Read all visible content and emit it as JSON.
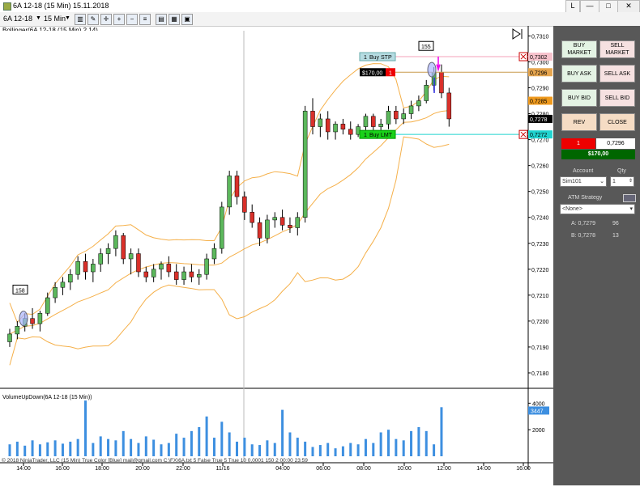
{
  "window": {
    "title": "6A 12-18 (15 Min)  15.11.2018",
    "btn_help": "L",
    "btn_min": "—",
    "btn_max": "□",
    "btn_close": "✕"
  },
  "toolbar": {
    "instrument": "6A 12-18",
    "interval": "15 Min"
  },
  "indicator_labels": {
    "bollinger": "Bollinger(6A 12-18 (15 Min),2,14)",
    "volume": "VolumeUpDown(6A 12-18 (15 Min))"
  },
  "price_axis": [
    "0,7310",
    "0,7300",
    "0,7290",
    "0,7280",
    "0,7270",
    "0,7260",
    "0,7250",
    "0,7240",
    "0,7230",
    "0,7220",
    "0,7210",
    "0,7200",
    "0,7190",
    "0,7180"
  ],
  "price_tags": {
    "stop": "0,7302",
    "upper": "0,7296",
    "mid": "0,7285",
    "last": "0,7278",
    "limit": "0,7272"
  },
  "orders": {
    "stop_label": "Buy STP",
    "stop_qty": "1",
    "limit_label": "Buy LMT",
    "limit_qty": "1",
    "pnl": "$170,00",
    "position_qty": "1"
  },
  "markers": {
    "bar_count_left": "158",
    "bar_count_right": "155"
  },
  "time_axis": [
    "14:00",
    "16:00",
    "18:00",
    "20:00",
    "22:00",
    "11/16",
    "04:00",
    "06:00",
    "08:00",
    "10:00",
    "12:00",
    "14:00",
    "16:00"
  ],
  "volume_axis": {
    "top": "4000",
    "bottom": "2000",
    "current": "3447"
  },
  "footer": "© 2018 NinjaTrader, LLC  (15 Min) True Color [Blue] mail@gmail.com C:\\FX\\6A.txt 5 False True 5 True 10 0,0001 150 2 00:00 23:59",
  "panel": {
    "buy_market": "BUY MARKET",
    "sell_market": "SELL MARKET",
    "buy_ask": "BUY ASK",
    "sell_ask": "SELL ASK",
    "buy_bid": "BUY BID",
    "sell_bid": "SELL BID",
    "rev": "REV",
    "close": "CLOSE",
    "pos_qty": "1",
    "pos_price": "0,7296",
    "pnl": "$170,00",
    "account_label": "Account",
    "qty_label": "Qty",
    "account": "Sim101",
    "qty": "1",
    "atm_label": "ATM Strategy",
    "atm": "<None>",
    "ask_label": "A: 0,7279",
    "ask_size": "96",
    "bid_label": "B: 0,7278",
    "bid_size": "13"
  },
  "colors": {
    "up": "#5cb85c",
    "down": "#d9302a",
    "band": "#f5b04a",
    "volume": "#3d8fe0",
    "panel": "#585858"
  },
  "chart_data": {
    "type": "candlestick",
    "title": "6A 12-18 (15 Min)",
    "ylim": [
      0.7175,
      0.7312
    ],
    "candles": [
      [
        0.7192,
        0.7197,
        0.719,
        0.7195
      ],
      [
        0.7195,
        0.72,
        0.7193,
        0.7198
      ],
      [
        0.7198,
        0.7203,
        0.7196,
        0.7201
      ],
      [
        0.7201,
        0.7205,
        0.7197,
        0.7199
      ],
      [
        0.7199,
        0.7204,
        0.7196,
        0.7203
      ],
      [
        0.7203,
        0.7211,
        0.7202,
        0.7209
      ],
      [
        0.7209,
        0.7215,
        0.7207,
        0.7213
      ],
      [
        0.7213,
        0.7217,
        0.721,
        0.7215
      ],
      [
        0.7215,
        0.722,
        0.7212,
        0.7218
      ],
      [
        0.7218,
        0.7225,
        0.7216,
        0.7223
      ],
      [
        0.7223,
        0.7226,
        0.7216,
        0.7219
      ],
      [
        0.7219,
        0.7224,
        0.7215,
        0.7222
      ],
      [
        0.7222,
        0.7228,
        0.7219,
        0.7226
      ],
      [
        0.7226,
        0.723,
        0.7222,
        0.7228
      ],
      [
        0.7228,
        0.7235,
        0.7225,
        0.7233
      ],
      [
        0.7233,
        0.7234,
        0.7222,
        0.7224
      ],
      [
        0.7224,
        0.7228,
        0.7218,
        0.7226
      ],
      [
        0.7226,
        0.7228,
        0.7217,
        0.7219
      ],
      [
        0.7219,
        0.7221,
        0.7215,
        0.7217
      ],
      [
        0.7217,
        0.7222,
        0.7215,
        0.722
      ],
      [
        0.722,
        0.7223,
        0.7216,
        0.7222
      ],
      [
        0.7222,
        0.7225,
        0.7217,
        0.7219
      ],
      [
        0.7219,
        0.7222,
        0.7214,
        0.7216
      ],
      [
        0.7216,
        0.7221,
        0.7214,
        0.7219
      ],
      [
        0.7219,
        0.7222,
        0.7215,
        0.7217
      ],
      [
        0.7217,
        0.722,
        0.7214,
        0.7218
      ],
      [
        0.7218,
        0.7226,
        0.7216,
        0.7224
      ],
      [
        0.7224,
        0.723,
        0.7222,
        0.7228
      ],
      [
        0.7228,
        0.7246,
        0.7226,
        0.7244
      ],
      [
        0.7244,
        0.7258,
        0.7241,
        0.7256
      ],
      [
        0.7256,
        0.7258,
        0.7245,
        0.7248
      ],
      [
        0.7248,
        0.725,
        0.7239,
        0.7242
      ],
      [
        0.7242,
        0.7245,
        0.7236,
        0.7238
      ],
      [
        0.7238,
        0.724,
        0.7229,
        0.7232
      ],
      [
        0.7232,
        0.7241,
        0.723,
        0.7239
      ],
      [
        0.7239,
        0.7242,
        0.7236,
        0.724
      ],
      [
        0.724,
        0.7243,
        0.7235,
        0.7237
      ],
      [
        0.7237,
        0.724,
        0.7234,
        0.7236
      ],
      [
        0.7236,
        0.7242,
        0.7233,
        0.724
      ],
      [
        0.724,
        0.7283,
        0.7238,
        0.7281
      ],
      [
        0.7281,
        0.7286,
        0.7272,
        0.7275
      ],
      [
        0.7275,
        0.728,
        0.7271,
        0.7278
      ],
      [
        0.7278,
        0.7281,
        0.727,
        0.7273
      ],
      [
        0.7273,
        0.7277,
        0.727,
        0.7276
      ],
      [
        0.7276,
        0.7278,
        0.7272,
        0.7274
      ],
      [
        0.7274,
        0.7277,
        0.727,
        0.7272
      ],
      [
        0.7272,
        0.7276,
        0.7271,
        0.7275
      ],
      [
        0.7275,
        0.728,
        0.7273,
        0.7279
      ],
      [
        0.7279,
        0.728,
        0.7273,
        0.7275
      ],
      [
        0.7275,
        0.7278,
        0.7273,
        0.7276
      ],
      [
        0.7276,
        0.7283,
        0.7274,
        0.7281
      ],
      [
        0.7281,
        0.7283,
        0.7276,
        0.7278
      ],
      [
        0.7278,
        0.7282,
        0.7276,
        0.728
      ],
      [
        0.728,
        0.7285,
        0.7278,
        0.7283
      ],
      [
        0.7283,
        0.7287,
        0.7281,
        0.7285
      ],
      [
        0.7285,
        0.7293,
        0.7284,
        0.7291
      ],
      [
        0.7291,
        0.7298,
        0.7289,
        0.7296
      ],
      [
        0.7296,
        0.7299,
        0.7286,
        0.7288
      ],
      [
        0.7288,
        0.729,
        0.7275,
        0.7278
      ]
    ],
    "volume": [
      900,
      1100,
      800,
      1200,
      900,
      1050,
      1200,
      950,
      1100,
      1300,
      4200,
      1000,
      1500,
      1300,
      1200,
      1900,
      1300,
      1000,
      1500,
      1250,
      900,
      1000,
      1700,
      1400,
      1900,
      2200,
      3000,
      1400,
      2600,
      1800,
      1100,
      1400,
      900,
      850,
      1200,
      1000,
      3500,
      1800,
      1400,
      1100,
      700,
      850,
      1000,
      600,
      750,
      1000,
      900,
      1300,
      1000,
      1800,
      2000,
      1300,
      1200,
      1900,
      2200,
      1900,
      900,
      3700
    ]
  }
}
